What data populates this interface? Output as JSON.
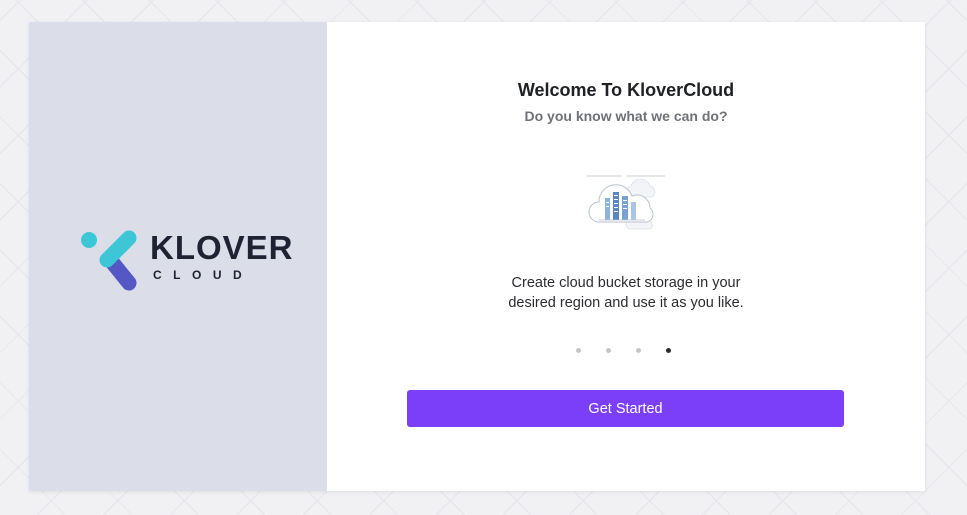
{
  "brand": {
    "name": "KLOVER",
    "sub": "CLOUD",
    "colors": {
      "teal": "#3dc7d6",
      "indigo": "#5458c4",
      "text": "#1f2233"
    }
  },
  "welcome": {
    "title": "Welcome To KloverCloud",
    "subtitle": "Do you know what we can do?"
  },
  "slide": {
    "illustration": "cloud-storage-illustration",
    "description_line1": "Create cloud bucket storage in your",
    "description_line2": "desired region and use it as you like."
  },
  "carousel": {
    "total": 4,
    "active": 4
  },
  "cta": {
    "label": "Get Started",
    "color": "#7b3ff9"
  },
  "colors": {
    "left_panel": "#dbdde9",
    "background": "#f1f1f4"
  }
}
